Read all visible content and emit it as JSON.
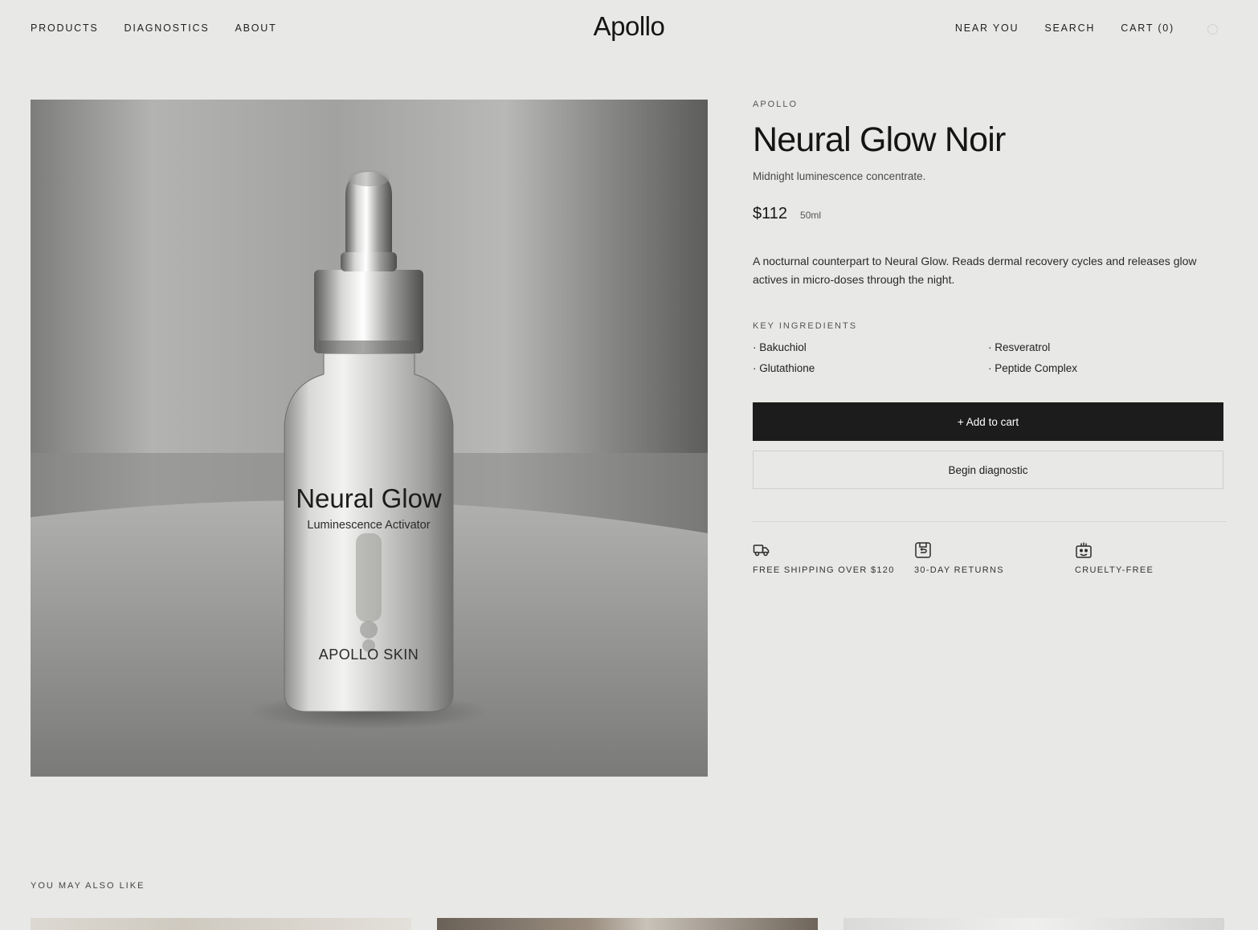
{
  "header": {
    "nav_left": [
      "PRODUCTS",
      "DIAGNOSTICS",
      "ABOUT"
    ],
    "logo": "Apollo",
    "nav_right": [
      "NEAR YOU",
      "SEARCH",
      "CART (0)"
    ]
  },
  "product": {
    "brand": "APOLLO",
    "title": "Neural Glow Noir",
    "tagline": "Midnight luminescence concentrate.",
    "price": "$112",
    "size": "50ml",
    "description": "A nocturnal counterpart to Neural Glow. Reads dermal recovery cycles and releases glow actives in micro-doses through the night.",
    "ingredients_heading": "KEY INGREDIENTS",
    "ingredients": [
      "· Bakuchiol",
      "· Resveratrol",
      "· Glutathione",
      "· Peptide Complex"
    ],
    "add_to_cart": "+ Add to cart",
    "begin_diagnostic": "Begin diagnostic"
  },
  "image_label": {
    "name": "Neural Glow",
    "subtitle": "Luminescence Activator",
    "brand": "APOLLO SKIN"
  },
  "features": [
    {
      "icon": "truck-icon",
      "label": "FREE SHIPPING OVER $120"
    },
    {
      "icon": "return-box-icon",
      "label": "30-DAY RETURNS"
    },
    {
      "icon": "rabbit-icon",
      "label": "CRUELTY-FREE"
    }
  ],
  "related": {
    "heading": "YOU MAY ALSO LIKE"
  },
  "colors": {
    "background": "#e8e8e6",
    "primary_button": "#1c1c1c",
    "text": "#1a1a1a"
  }
}
